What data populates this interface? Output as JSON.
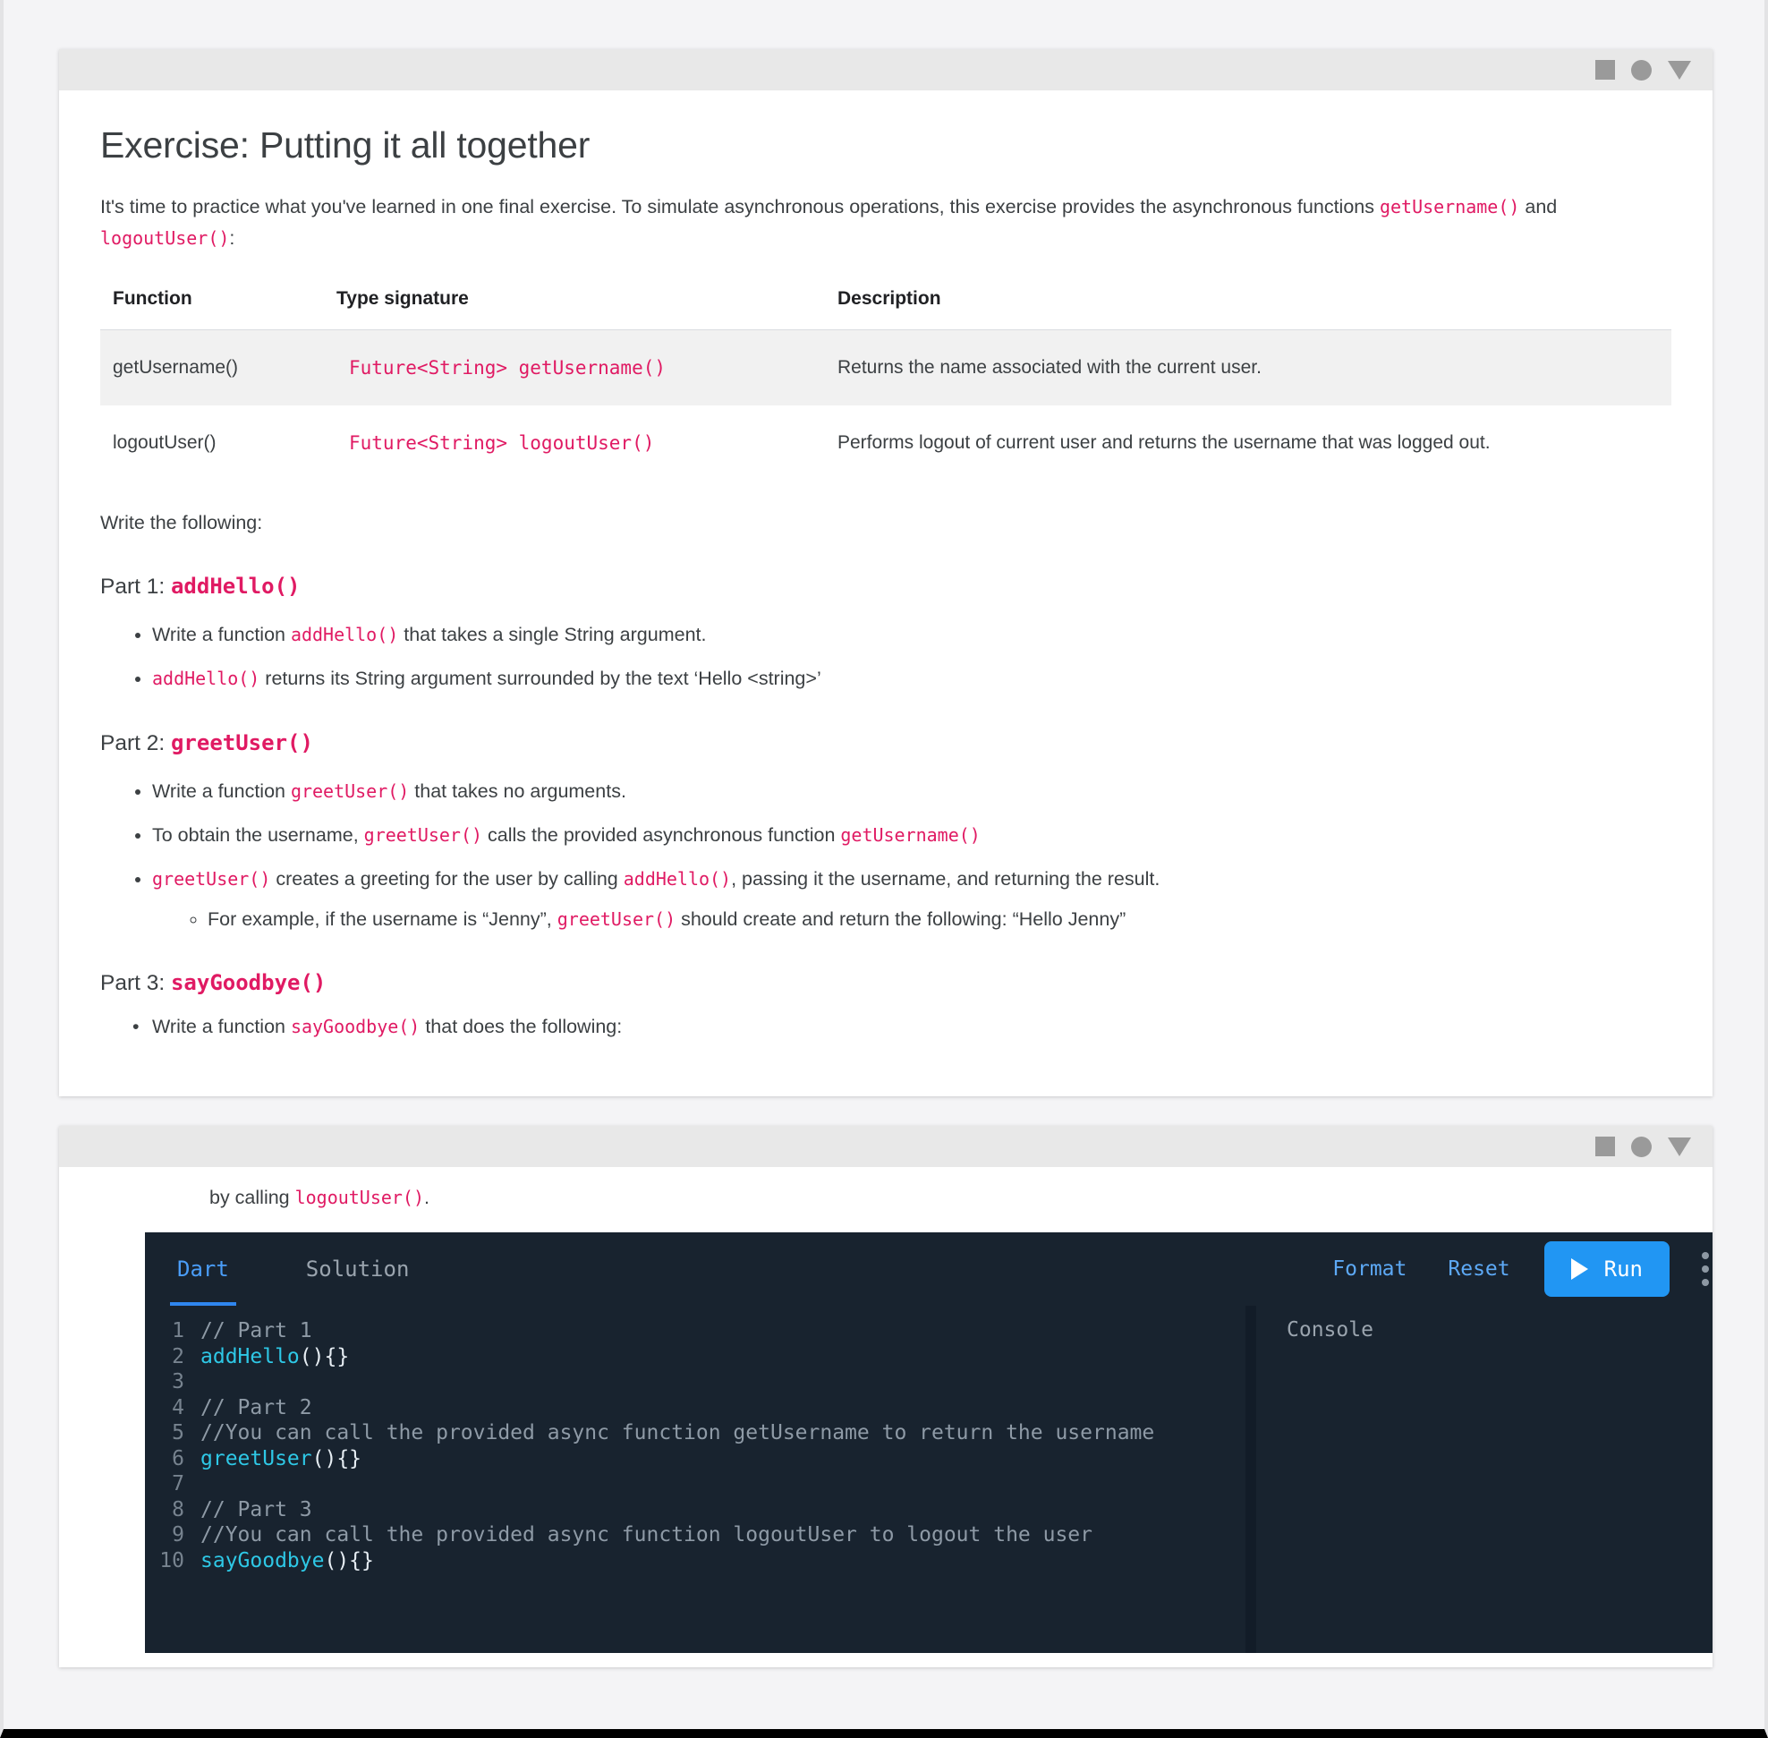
{
  "window_controls": {
    "minimize": "square-icon",
    "maximize": "circle-icon",
    "collapse": "triangle-down-icon"
  },
  "document": {
    "title": "Exercise: Putting it all together",
    "intro_1": "It's time to practice what you've learned in one final exercise. To simulate asynchronous operations, this exercise provides the asynchronous functions ",
    "intro_fn1": "getUsername()",
    "intro_and": " and ",
    "intro_fn2": "logoutUser()",
    "intro_end": ":",
    "table": {
      "headers": [
        "Function",
        "Type signature",
        "Description"
      ],
      "rows": [
        {
          "function": "getUsername()",
          "signature": "Future<String> getUsername()",
          "description": "Returns the name associated with the current user."
        },
        {
          "function": "logoutUser()",
          "signature": "Future<String> logoutUser()",
          "description": "Performs logout of current user and returns the username that was logged out."
        }
      ]
    },
    "write_following": "Write the following:",
    "part1": {
      "label": "Part 1: ",
      "name": "addHello()",
      "bullets": [
        {
          "pre": "Write a function ",
          "code": "addHello()",
          "post": " that takes a single String argument."
        },
        {
          "pre": "",
          "code": "addHello()",
          "post": " returns its String argument surrounded by the text ‘Hello <string>’"
        }
      ]
    },
    "part2": {
      "label": "Part 2: ",
      "name": "greetUser()",
      "bullets": [
        {
          "pre": "Write a function ",
          "code": "greetUser()",
          "post": " that takes no arguments."
        },
        {
          "pre": "To obtain the username, ",
          "code": "greetUser()",
          "post": " calls the provided asynchronous function ",
          "code2": "getUsername()",
          "post2": ""
        },
        {
          "pre": "",
          "code": "greetUser()",
          "post": " creates a greeting for the user by calling ",
          "code2": "addHello()",
          "post2": ", passing it the username, and returning the result."
        }
      ],
      "subbullet": {
        "pre": "For example, if the username is “Jenny”, ",
        "code": "greetUser()",
        "post": " should create and return the following: “Hello Jenny”"
      }
    },
    "part3": {
      "label": "Part 3: ",
      "name": "sayGoodbye()",
      "clipped_bullet_pre": "Write a function ",
      "clipped_bullet_code": "sayGoodbye()",
      "clipped_bullet_post": " that does the following:"
    }
  },
  "editor_panel": {
    "intro_pre": "by calling ",
    "intro_code": "logoutUser()",
    "intro_post": ".",
    "toolbar": {
      "tab_dart": "Dart",
      "tab_solution": "Solution",
      "format_label": "Format",
      "reset_label": "Reset",
      "run_label": "Run",
      "more_icon": "kebab-menu-icon",
      "play_icon": "play-icon"
    },
    "code_lines": [
      {
        "n": "1",
        "kind": "comment",
        "text": "// Part 1"
      },
      {
        "n": "2",
        "kind": "fn",
        "fn": "addHello",
        "rest": "(){}"
      },
      {
        "n": "3",
        "kind": "blank",
        "text": ""
      },
      {
        "n": "4",
        "kind": "comment",
        "text": "// Part 2"
      },
      {
        "n": "5",
        "kind": "comment",
        "text": "//You can call the provided async function getUsername to return the username"
      },
      {
        "n": "6",
        "kind": "fn",
        "fn": "greetUser",
        "rest": "(){}"
      },
      {
        "n": "7",
        "kind": "blank",
        "text": ""
      },
      {
        "n": "8",
        "kind": "comment",
        "text": "// Part 3"
      },
      {
        "n": "9",
        "kind": "comment",
        "text": "//You can call the provided async function logoutUser to logout the user"
      },
      {
        "n": "10",
        "kind": "fn",
        "fn": "sayGoodbye",
        "rest": "(){}"
      }
    ],
    "console_label": "Console",
    "console_output": ""
  },
  "colors": {
    "accent_pink": "#e01a63",
    "run_blue": "#2196f3",
    "tab_active_blue": "#4a9df8",
    "editor_bg": "#18232f",
    "fn_cyan": "#2ec8e6"
  }
}
